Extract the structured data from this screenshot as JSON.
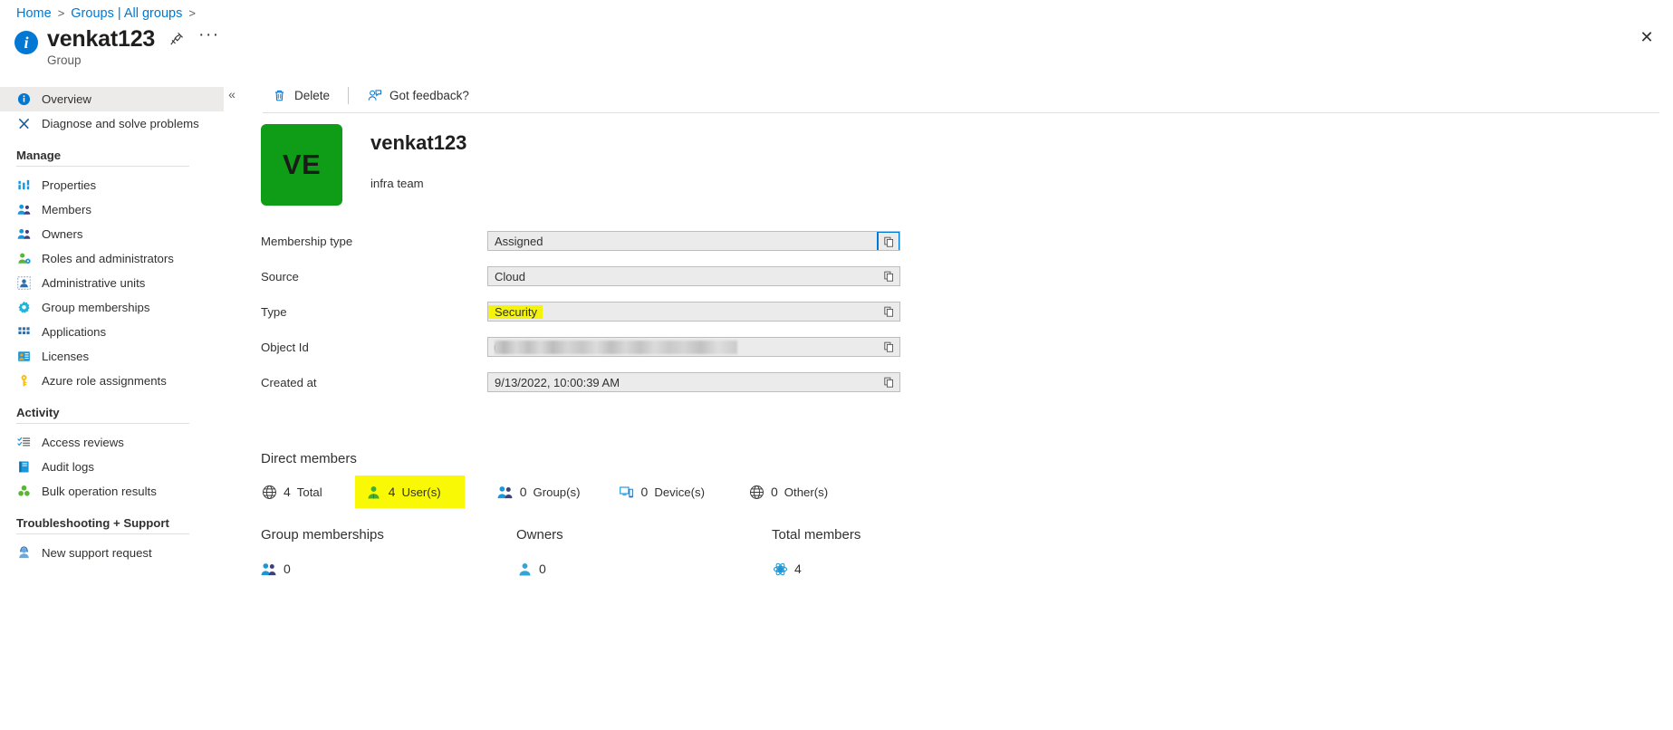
{
  "breadcrumb": {
    "items": [
      {
        "label": "Home"
      },
      {
        "label": "Groups | All groups"
      }
    ],
    "separator": ">"
  },
  "header": {
    "title": "venkat123",
    "subtitle": "Group",
    "info_icon": "info-icon",
    "pin_icon": "pin-icon",
    "more_icon": "ellipsis-icon",
    "close_icon": "close-icon"
  },
  "sidebar": {
    "collapse_icon": "chevron-double-left-icon",
    "groups": [
      {
        "heading": null,
        "items": [
          {
            "label": "Overview",
            "icon": "info-circle-icon",
            "selected": true
          },
          {
            "label": "Diagnose and solve problems",
            "icon": "wrench-screwdriver-icon",
            "selected": false
          }
        ]
      },
      {
        "heading": "Manage",
        "items": [
          {
            "label": "Properties",
            "icon": "properties-bars-icon",
            "selected": false
          },
          {
            "label": "Members",
            "icon": "members-people-icon",
            "selected": false
          },
          {
            "label": "Owners",
            "icon": "owners-people-icon",
            "selected": false
          },
          {
            "label": "Roles and administrators",
            "icon": "role-person-gear-icon",
            "selected": false
          },
          {
            "label": "Administrative units",
            "icon": "administrative-units-icon",
            "selected": false
          },
          {
            "label": "Group memberships",
            "icon": "gear-icon",
            "selected": false
          },
          {
            "label": "Applications",
            "icon": "applications-grid-icon",
            "selected": false
          },
          {
            "label": "Licenses",
            "icon": "license-badge-icon",
            "selected": false
          },
          {
            "label": "Azure role assignments",
            "icon": "key-icon",
            "selected": false
          }
        ]
      },
      {
        "heading": "Activity",
        "items": [
          {
            "label": "Access reviews",
            "icon": "checklist-icon",
            "selected": false
          },
          {
            "label": "Audit logs",
            "icon": "book-icon",
            "selected": false
          },
          {
            "label": "Bulk operation results",
            "icon": "bulk-clover-icon",
            "selected": false
          }
        ]
      },
      {
        "heading": "Troubleshooting + Support",
        "items": [
          {
            "label": "New support request",
            "icon": "support-agent-icon",
            "selected": false
          }
        ]
      }
    ]
  },
  "commandbar": {
    "delete_label": "Delete",
    "delete_icon": "trash-icon",
    "feedback_label": "Got feedback?",
    "feedback_icon": "feedback-person-icon"
  },
  "identity": {
    "avatar_initials": "VE",
    "avatar_color": "#0f9d17",
    "name": "venkat123",
    "description": "infra team"
  },
  "properties": {
    "copy_icon": "copy-icon",
    "rows": [
      {
        "label": "Membership type",
        "value": "Assigned",
        "highlight": false,
        "redacted": false,
        "copy_focused": true
      },
      {
        "label": "Source",
        "value": "Cloud",
        "highlight": false,
        "redacted": false,
        "copy_focused": false
      },
      {
        "label": "Type",
        "value": "Security",
        "highlight": true,
        "redacted": false,
        "copy_focused": false
      },
      {
        "label": "Object Id",
        "value": "",
        "highlight": false,
        "redacted": true,
        "copy_focused": false
      },
      {
        "label": "Created at",
        "value": "9/13/2022, 10:00:39 AM",
        "highlight": false,
        "redacted": false,
        "copy_focused": false
      }
    ]
  },
  "direct_members": {
    "heading": "Direct members",
    "items": [
      {
        "count": "4",
        "label": "Total",
        "icon": "globe-icon",
        "highlight": false
      },
      {
        "count": "4",
        "label": "User(s)",
        "icon": "user-green-icon",
        "highlight": true
      },
      {
        "count": "0",
        "label": "Group(s)",
        "icon": "group-people-icon",
        "highlight": false
      },
      {
        "count": "0",
        "label": "Device(s)",
        "icon": "device-monitor-icon",
        "highlight": false
      },
      {
        "count": "0",
        "label": "Other(s)",
        "icon": "globe-icon",
        "highlight": false
      }
    ]
  },
  "summary_stats": [
    {
      "title": "Group memberships",
      "value": "0",
      "icon": "group-people-icon"
    },
    {
      "title": "Owners",
      "value": "0",
      "icon": "user-blue-icon"
    },
    {
      "title": "Total members",
      "value": "4",
      "icon": "atom-members-icon"
    }
  ],
  "colors": {
    "accent": "#0078d4",
    "highlight_yellow": "#f9f906",
    "avatar_green": "#0f9d17",
    "selected_nav": "#edebe9"
  }
}
